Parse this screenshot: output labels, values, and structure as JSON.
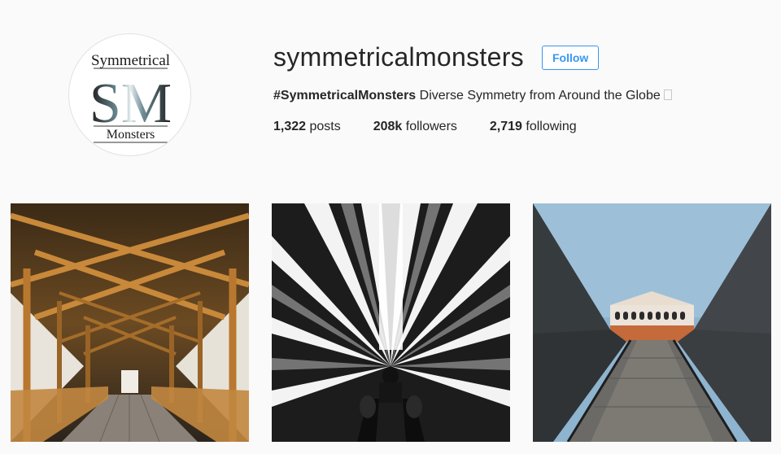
{
  "profile": {
    "username": "symmetricalmonsters",
    "follow_label": "Follow",
    "bio_tag": "#SymmetricalMonsters",
    "bio_text": " Diverse Symmetry from Around the Globe",
    "logo": {
      "top_text": "Symmetrical",
      "initials": "SM",
      "bottom_text": "Monsters"
    }
  },
  "stats": {
    "posts_count": "1,322",
    "posts_label": " posts",
    "followers_count": "208k",
    "followers_label": " followers",
    "following_count": "2,719",
    "following_label": " following"
  },
  "posts": [
    {
      "subject": "covered wooden bridge"
    },
    {
      "subject": "mirrored escalator tunnel"
    },
    {
      "subject": "concrete ramp leading to arched building"
    }
  ],
  "colors": {
    "background": "#fafafa",
    "accent": "#3897f0",
    "text": "#262626"
  }
}
